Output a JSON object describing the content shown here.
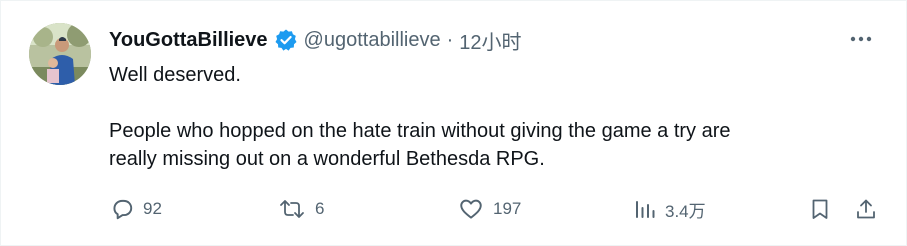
{
  "tweet": {
    "display_name": "YouGottaBillieve",
    "handle": "@ugottabillieve",
    "separator": "·",
    "time": "12小时",
    "text_line1": "Well deserved.",
    "text_line2": "People who hopped on the hate train without giving the game a try are",
    "text_line3": "really missing out on a wonderful Bethesda RPG."
  },
  "actions": {
    "replies": "92",
    "retweets": "6",
    "likes": "197",
    "views": "3.4万"
  },
  "colors": {
    "verified": "#1d9bf0",
    "secondary_text": "#536471",
    "primary_text": "#0f1419"
  },
  "icons": {
    "verified": "verified-badge-icon",
    "more": "more-options-icon",
    "reply": "reply-icon",
    "retweet": "retweet-icon",
    "like": "heart-icon",
    "views": "views-chart-icon",
    "bookmark": "bookmark-icon",
    "share": "share-icon"
  }
}
